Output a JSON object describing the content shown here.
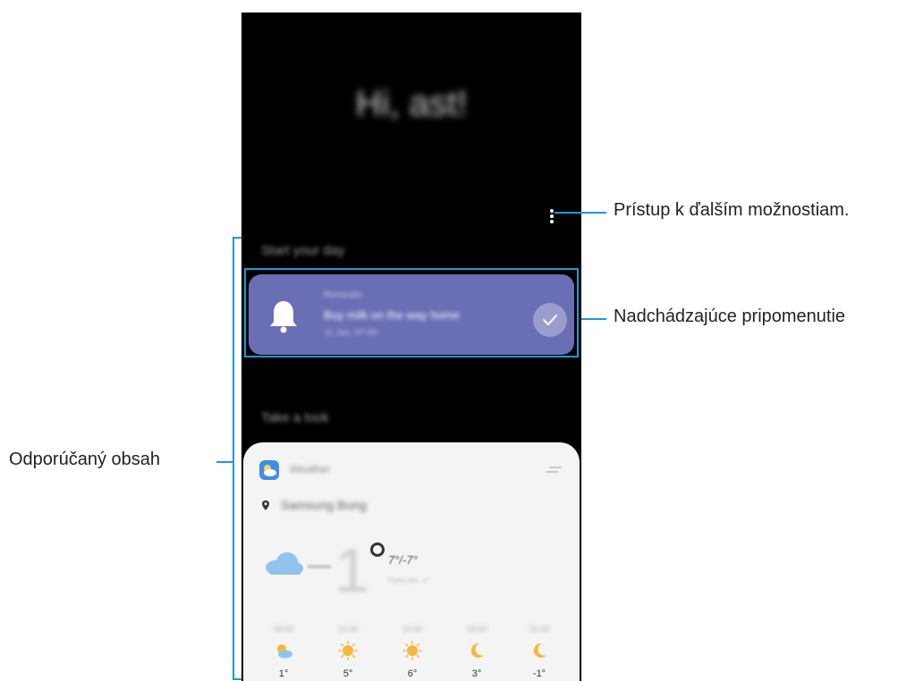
{
  "phone": {
    "greeting": "Hi, ast!",
    "section_start": "Start your day",
    "reminder": {
      "label": "Reminder",
      "title": "Buy milk on the way home",
      "time": "11 Jan, 07:00"
    },
    "section_look": "Take a look",
    "weather": {
      "app_name": "Weather",
      "location": "Samsung Bong",
      "current_temp": "1",
      "high_low": "7°/-7°",
      "feels_like": "Feels like -1°",
      "forecast": [
        {
          "time": "09:00",
          "icon": "partly-cloudy-icon",
          "temp": "1°"
        },
        {
          "time": "12:00",
          "icon": "sun-icon",
          "temp": "5°"
        },
        {
          "time": "15:00",
          "icon": "sun-icon",
          "temp": "6°"
        },
        {
          "time": "18:00",
          "icon": "moon-icon",
          "temp": "3°"
        },
        {
          "time": "21:00",
          "icon": "moon-icon",
          "temp": "-1°"
        }
      ]
    }
  },
  "callouts": {
    "more_options": "Prístup k ďalším možnostiam.",
    "upcoming_reminder": "Nadchádzajúce pripomenutie",
    "recommended": "Odporúčaný obsah"
  },
  "colors": {
    "accent": "#1a9bd7",
    "reminder_card": "#6a6eb4",
    "sun": "#f6b73c",
    "cloud": "#8fc4ec"
  }
}
